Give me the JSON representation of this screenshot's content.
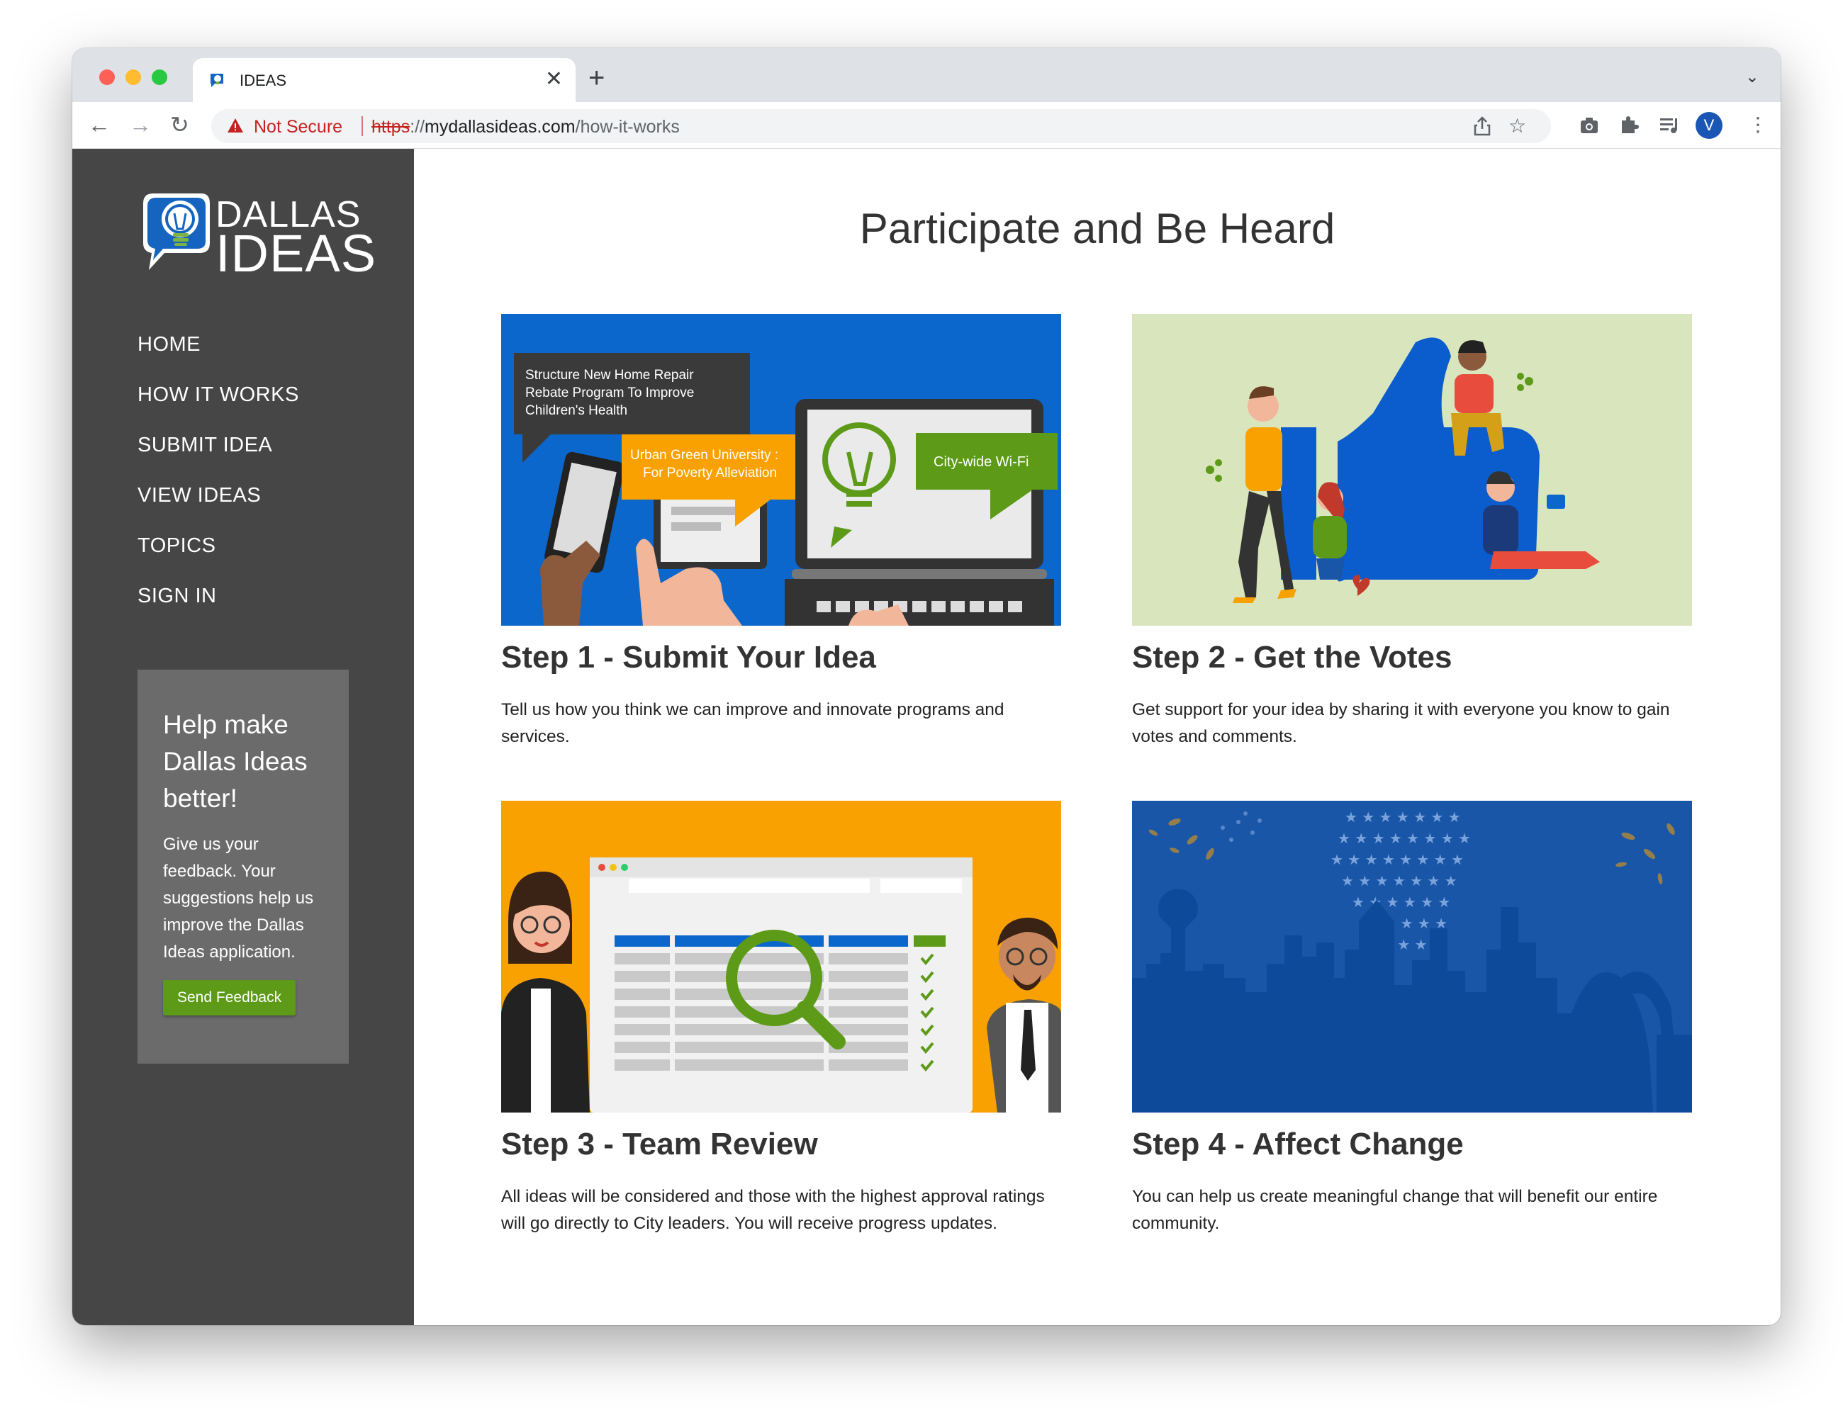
{
  "browser": {
    "tab_title": "IDEAS",
    "tab_close": "✕",
    "new_tab": "+",
    "security_label": "Not Secure",
    "url_scheme": "https",
    "url_sep": "://",
    "url_host": "mydallasideas.com",
    "url_path": "/how-it-works",
    "profile_initial": "V",
    "icons": [
      "back-icon",
      "forward-icon",
      "reload-icon",
      "share-icon",
      "bookmark-star-icon",
      "camera-icon",
      "extensions-icon",
      "media-icon",
      "menu-icon"
    ]
  },
  "logo": {
    "line1": "DALLAS",
    "line2": "IDEAS"
  },
  "nav": [
    {
      "label": "HOME"
    },
    {
      "label": "HOW IT WORKS"
    },
    {
      "label": "SUBMIT IDEA"
    },
    {
      "label": "VIEW IDEAS"
    },
    {
      "label": "TOPICS"
    },
    {
      "label": "SIGN IN"
    }
  ],
  "feedback": {
    "title": "Help make Dallas Ideas better!",
    "text": "Give us your feedback. Your suggestions help us improve the Dallas Ideas application.",
    "button": "Send Feedback"
  },
  "main": {
    "title": "Participate and Be Heard",
    "steps": [
      {
        "title": "Step 1 - Submit Your Idea",
        "description": "Tell us how you think we can improve and innovate programs and services.",
        "image_text": {
          "bubble1": [
            "Structure New Home Repair",
            "Rebate Program To Improve",
            "Children's Health"
          ],
          "bubble2": [
            "Urban Green University :",
            "For Poverty Alleviation"
          ],
          "bubble3": "City-wide Wi-Fi"
        }
      },
      {
        "title": "Step 2 - Get the Votes",
        "description": "Get support for your idea by sharing it with everyone you know to gain votes and comments."
      },
      {
        "title": "Step 3 - Team Review",
        "description": "All ideas will be considered and those with the highest approval ratings will go directly to City leaders. You will receive progress updates."
      },
      {
        "title": "Step 4 - Affect Change",
        "description": "You can help us create meaningful change that will benefit our entire community."
      }
    ]
  },
  "colors": {
    "sidebar": "#464646",
    "feedback_box": "#6b6b6b",
    "button_green": "#5c9a18",
    "step1_bg": "#0b67cc",
    "step2_bg": "#d9e5bd",
    "step3_bg": "#f8a100",
    "step4_bg": "#1a56a8"
  }
}
